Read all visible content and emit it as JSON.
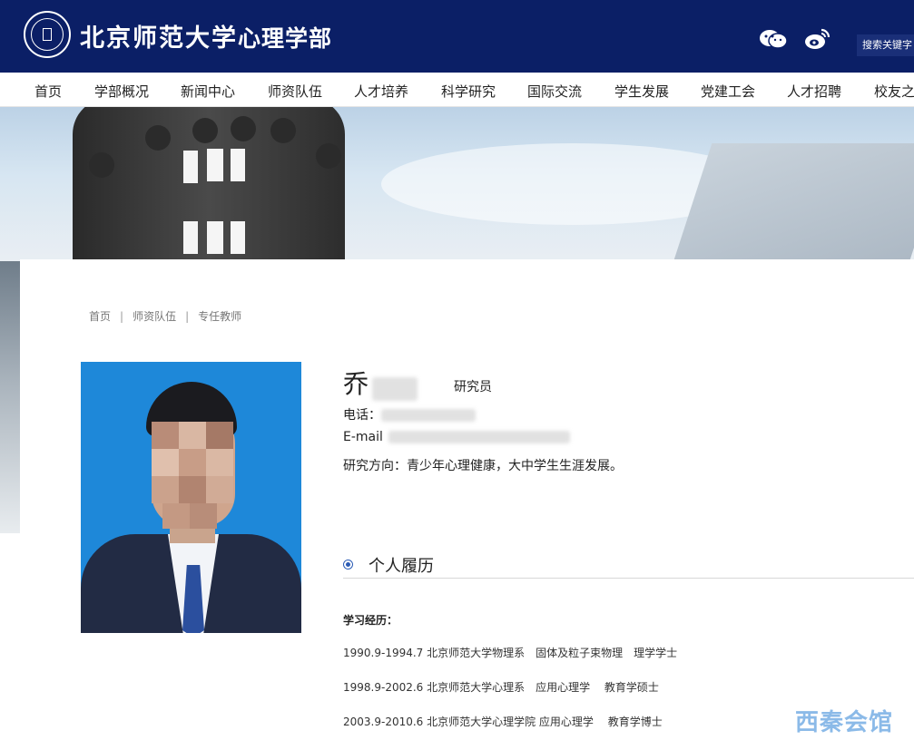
{
  "header": {
    "university": "北京师范大学",
    "department": "心理学部",
    "search_placeholder": "搜索关键字",
    "icons": [
      "wechat-icon",
      "weibo-icon"
    ],
    "brand_color": "#0b1f66"
  },
  "nav": {
    "items": [
      "首页",
      "学部概况",
      "新闻中心",
      "师资队伍",
      "人才培养",
      "科学研究",
      "国际交流",
      "学生发展",
      "党建工会",
      "人才招聘",
      "校友之"
    ]
  },
  "breadcrumb": [
    "首页",
    "师资队伍",
    "专任教师"
  ],
  "profile": {
    "surname": "乔",
    "title": "研究员",
    "phone_label": "电话：",
    "email_label": "E-mail",
    "research_label": "研究方向：",
    "research_value": "青少年心理健康，大中学生生涯发展。"
  },
  "section": {
    "title": "个人履历",
    "education_heading": "学习经历：",
    "education": [
      "1990.9-1994.7 北京师范大学物理系　固体及粒子束物理　理学学士",
      "1998.9-2002.6 北京师范大学心理系　应用心理学　 教育学硕士",
      "2003.9-2010.6 北京师范大学心理学院 应用心理学　 教育学博士"
    ]
  },
  "watermark": "西秦会馆"
}
